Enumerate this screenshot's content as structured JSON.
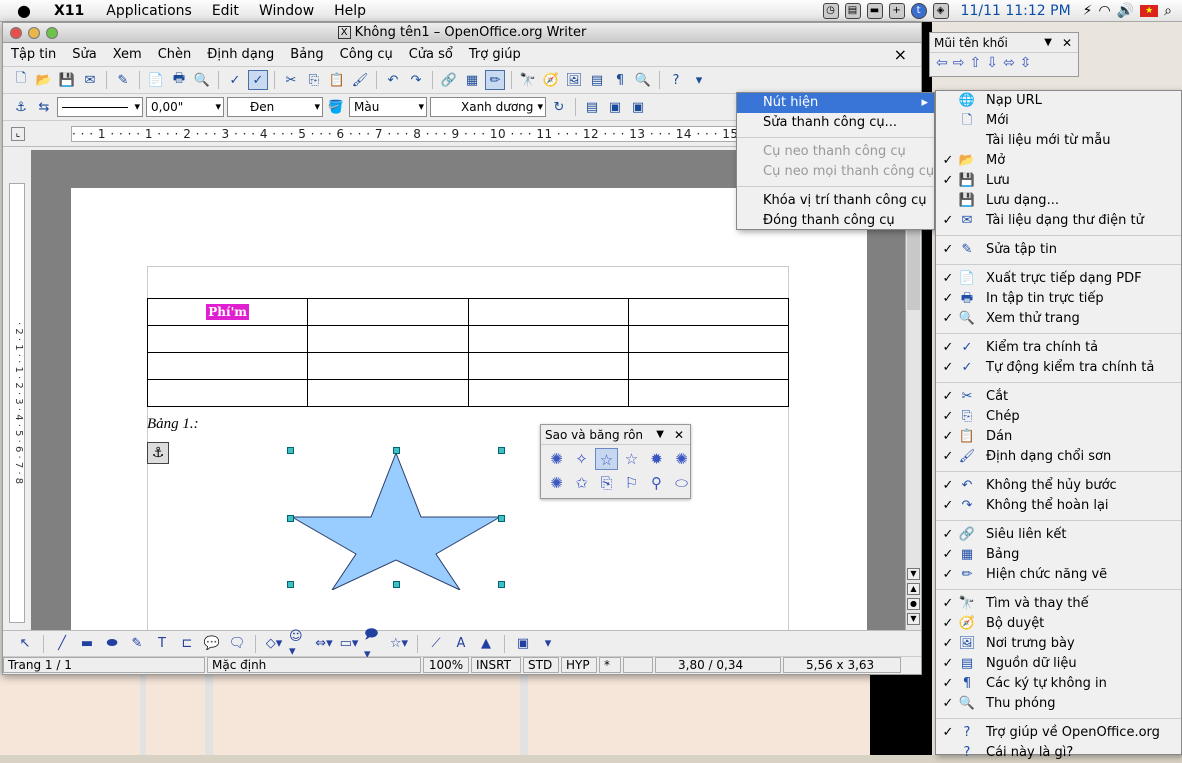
{
  "menubar": {
    "app": "X11",
    "items": [
      "Applications",
      "Edit",
      "Window",
      "Help"
    ],
    "clock": "11/11  11:12 PM"
  },
  "window": {
    "title": "Không tên1 – OpenOffice.org Writer",
    "x11": "X"
  },
  "appmenu": {
    "items": [
      "Tập tin",
      "Sửa",
      "Xem",
      "Chèn",
      "Định dạng",
      "Bảng",
      "Công cụ",
      "Cửa sổ",
      "Trợ giúp"
    ],
    "close": "×"
  },
  "formatting": {
    "line_width": "0,00\"",
    "line_color": "Đen",
    "area_style": "Màu",
    "area_color": "Xanh dương"
  },
  "ruler": {
    "ticks": "· · · 1 · · · · 1 · · · 2 · · · 3 · · · 4 · · · 5 · · · 6 · · · 7 · · · 8 · · · 9 · · · 10 · · · 11 · · · 12 · · · 13 · · · 14 · · · 15 ·"
  },
  "document": {
    "cell_text": "Phí'm",
    "caption": "Bảng 1.:",
    "anchor": "⚓"
  },
  "stars_palette": {
    "title": "Sao và băng rôn",
    "icons": [
      "✺",
      "✧",
      "☆",
      "☆",
      "✹",
      "✺",
      "✺",
      "✩",
      "⎘",
      "⚐",
      "⚲",
      "⬭"
    ]
  },
  "arrows_palette": {
    "title": "Mũi tên khối",
    "icons": [
      "⇦",
      "⇨",
      "⇧",
      "⇩",
      "⬄",
      "⇳"
    ]
  },
  "context_menu": {
    "items": [
      {
        "label": "Nút hiện",
        "state": "selected"
      },
      {
        "label": "Sửa thanh công cụ...",
        "state": "normal"
      },
      {
        "label": "Cụ neo thanh công cụ",
        "state": "disabled"
      },
      {
        "label": "Cụ neo mọi thanh công cụ",
        "state": "disabled"
      },
      {
        "label": "Khóa vị trí thanh công cụ",
        "state": "normal"
      },
      {
        "label": "Đóng thanh công cụ",
        "state": "normal"
      }
    ]
  },
  "submenu": {
    "groups": [
      [
        {
          "label": "Nạp URL",
          "checked": false,
          "icon": "🌐"
        },
        {
          "label": "Mới",
          "checked": false,
          "icon": "🗋"
        },
        {
          "label": "Tài liệu mới từ mẫu",
          "checked": false,
          "icon": ""
        },
        {
          "label": "Mở",
          "checked": true,
          "icon": "📂"
        },
        {
          "label": "Lưu",
          "checked": true,
          "icon": "💾"
        },
        {
          "label": "Lưu dạng...",
          "checked": false,
          "icon": "💾"
        },
        {
          "label": "Tài liệu dạng thư điện tử",
          "checked": true,
          "icon": "✉"
        }
      ],
      [
        {
          "label": "Sửa tập tin",
          "checked": true,
          "icon": "✎"
        }
      ],
      [
        {
          "label": "Xuất trực tiếp dạng PDF",
          "checked": true,
          "icon": "📄"
        },
        {
          "label": "In tập tin trực tiếp",
          "checked": true,
          "icon": "🖶"
        },
        {
          "label": "Xem thử trang",
          "checked": true,
          "icon": "🔍"
        }
      ],
      [
        {
          "label": "Kiểm tra chính tả",
          "checked": true,
          "icon": "✓"
        },
        {
          "label": "Tự động kiểm tra chính tả",
          "checked": true,
          "icon": "✓"
        }
      ],
      [
        {
          "label": "Cắt",
          "checked": true,
          "icon": "✂"
        },
        {
          "label": "Chép",
          "checked": true,
          "icon": "⎘"
        },
        {
          "label": "Dán",
          "checked": true,
          "icon": "📋"
        },
        {
          "label": "Định dạng chổi sơn",
          "checked": true,
          "icon": "🖌"
        }
      ],
      [
        {
          "label": "Không thể hủy bước",
          "checked": true,
          "icon": "↶"
        },
        {
          "label": "Không thể hoàn lại",
          "checked": true,
          "icon": "↷"
        }
      ],
      [
        {
          "label": "Siêu liên kết",
          "checked": true,
          "icon": "🔗"
        },
        {
          "label": "Bảng",
          "checked": true,
          "icon": "▦"
        },
        {
          "label": "Hiện chức năng vẽ",
          "checked": true,
          "icon": "✏"
        }
      ],
      [
        {
          "label": "Tìm và thay thế",
          "checked": true,
          "icon": "🔭"
        },
        {
          "label": "Bộ duyệt",
          "checked": true,
          "icon": "🧭"
        },
        {
          "label": "Nơi trưng bày",
          "checked": true,
          "icon": "🖼"
        },
        {
          "label": "Nguồn dữ liệu",
          "checked": true,
          "icon": "▤"
        },
        {
          "label": "Các ký tự không in",
          "checked": true,
          "icon": "¶"
        },
        {
          "label": "Thu phóng",
          "checked": true,
          "icon": "🔍"
        }
      ],
      [
        {
          "label": "Trợ giúp về OpenOffice.org",
          "checked": true,
          "icon": "?"
        },
        {
          "label": "Cái này là gì?",
          "checked": false,
          "icon": "?"
        }
      ]
    ]
  },
  "statusbar": {
    "page": "Trang 1 / 1",
    "style": "Mặc định",
    "zoom": "100%",
    "insert": "INSRT",
    "sel": "STD",
    "hyp": "HYP",
    "mod": "*",
    "pos": "3,80 / 0,34",
    "size": "5,56 x 3,63"
  },
  "colors": {
    "selection": "#3875d7",
    "star_fill": "#99ccff",
    "highlight": "#e020d0"
  }
}
